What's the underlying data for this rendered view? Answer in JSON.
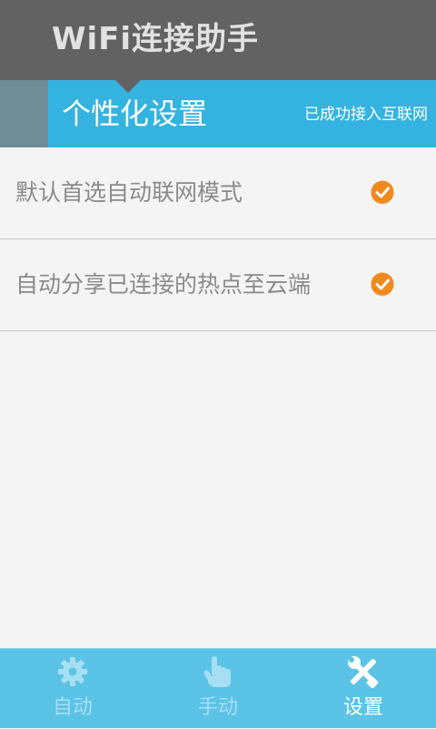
{
  "app": {
    "title": "WiFi连接助手"
  },
  "section": {
    "title": "个性化设置",
    "status": "已成功接入互联网"
  },
  "settings": [
    {
      "label": "默认首选自动联网模式",
      "checked": true
    },
    {
      "label": "自动分享已连接的热点至云端",
      "checked": true
    }
  ],
  "tabs": [
    {
      "label": "自动",
      "icon": "gear-icon",
      "active": false
    },
    {
      "label": "手动",
      "icon": "hand-pointer-icon",
      "active": false
    },
    {
      "label": "设置",
      "icon": "tools-icon",
      "active": true
    }
  ],
  "colors": {
    "header_bg": "#626262",
    "accent": "#35b3e0",
    "tab_bar_bg": "#5bc3e6",
    "check_orange": "#f08a1c"
  }
}
